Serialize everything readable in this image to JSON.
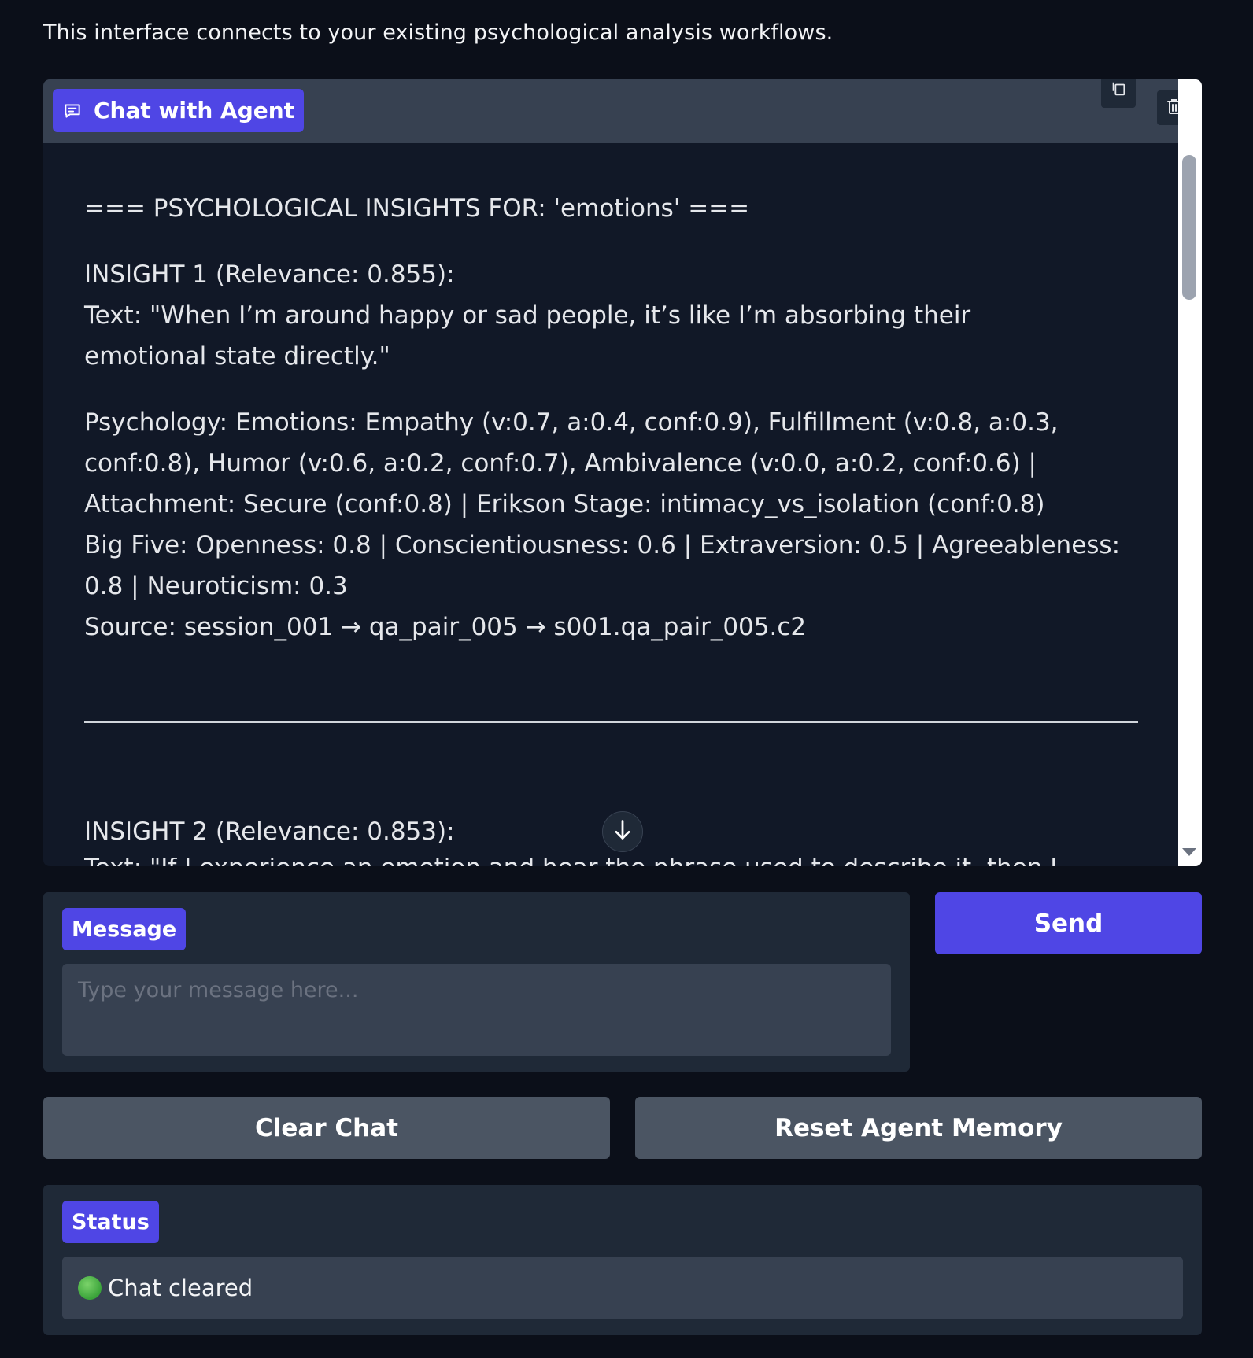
{
  "intro_text": "This interface connects to your existing psychological analysis workflows.",
  "chat": {
    "label": "Chat with Agent",
    "heading": "=== PSYCHOLOGICAL INSIGHTS FOR: 'emotions' ===",
    "insight1": {
      "title": "INSIGHT 1 (Relevance: 0.855):",
      "text_line1": "Text: \"When I’m around happy or sad people, it’s like I’m absorbing their",
      "text_line2": "emotional state directly.\"",
      "psych_line1": "Psychology: Emotions: Empathy (v:0.7, a:0.4, conf:0.9), Fulfillment (v:0.8, a:0.3,",
      "psych_line2": "conf:0.8), Humor (v:0.6, a:0.2, conf:0.7), Ambivalence (v:0.0, a:0.2, conf:0.6) |",
      "psych_line3": "Attachment: Secure (conf:0.8) | Erikson Stage: intimacy_vs_isolation (conf:0.8)",
      "psych_line4": "Big Five: Openness: 0.8 | Conscientiousness: 0.6 | Extraversion: 0.5 | Agreeableness:",
      "psych_line5": "0.8 | Neuroticism: 0.3",
      "source": "Source: session_001 → qa_pair_005 → s001.qa_pair_005.c2"
    },
    "insight2": {
      "title": "INSIGHT 2 (Relevance: 0.853):",
      "text_cutoff": "Text: \"If I experience an emotion and hear the phrase used to describe it, then I can understand it"
    }
  },
  "message": {
    "label": "Message",
    "placeholder": "Type your message here...",
    "value": ""
  },
  "buttons": {
    "send": "Send",
    "clear_chat": "Clear Chat",
    "reset_memory": "Reset Agent Memory"
  },
  "status": {
    "label": "Status",
    "text": "Chat cleared",
    "indicator_color": "#3aa33a"
  },
  "icons": {
    "chat_label_icon": "chat-bubble-icon",
    "copy": "copy-icon",
    "delete": "trash-icon",
    "scroll_down": "arrow-down-icon"
  },
  "colors": {
    "accent": "#4f46e5",
    "background": "#0b0f19",
    "panel": "#1f2937",
    "secondary_button": "#4b5563"
  }
}
